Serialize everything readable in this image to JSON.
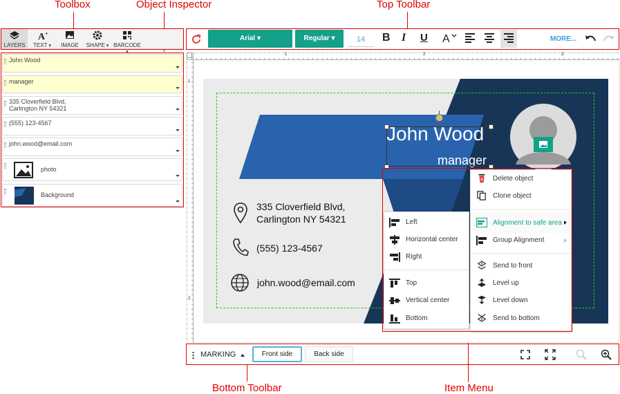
{
  "annotations": {
    "toolbox": "Toolbox",
    "object_inspector": "Object Inspector",
    "top_toolbar": "Top Toolbar",
    "bottom_toolbar": "Bottom Toolbar",
    "item_menu": "Item Menu"
  },
  "toolbox": {
    "layers": "LAYERS",
    "text": "TEXT",
    "image": "IMAGE",
    "shape": "SHAPE",
    "barcode": "BARCODE"
  },
  "layers": [
    {
      "label": "John Wood"
    },
    {
      "label": "manager"
    },
    {
      "label": "335 Cloverfield Blvd,\nCarlington NY 54321"
    },
    {
      "label": "(555) 123-4567"
    },
    {
      "label": "john.wood@email.com"
    },
    {
      "label": "photo"
    },
    {
      "label": "Background"
    }
  ],
  "toptoolbar": {
    "font": "Arial",
    "weight": "Regular",
    "size": "14",
    "bold": "B",
    "italic": "I",
    "underline": "U",
    "more": "MORE..."
  },
  "card": {
    "name": "John Wood",
    "title": "manager",
    "address1": "335 Cloverfield Blvd,",
    "address2": "Carlington NY 54321",
    "phone": "(555) 123-4567",
    "email": "john.wood@email.com"
  },
  "ruler": {
    "top": [
      "1",
      "2",
      "3"
    ],
    "left": [
      "1",
      "2"
    ]
  },
  "item_menu": {
    "delete": "Delete object",
    "clone": "Clone object",
    "align_safe": "Alignment to safe area",
    "group_align": "Group Alignment",
    "send_front": "Send to front",
    "level_up": "Level up",
    "level_down": "Level down",
    "send_bottom": "Send to bottom"
  },
  "align_menu": {
    "left": "Left",
    "hcenter": "Horizontal center",
    "right": "Right",
    "top": "Top",
    "vcenter": "Vertical center",
    "bottom": "Bottom"
  },
  "bottombar": {
    "marking": "MARKING",
    "front": "Front side",
    "back": "Back side"
  },
  "colors": {
    "accent": "#13a18a",
    "annotation": "#e00000",
    "dark_blue": "#173557",
    "mid_blue": "#2a63ad"
  }
}
